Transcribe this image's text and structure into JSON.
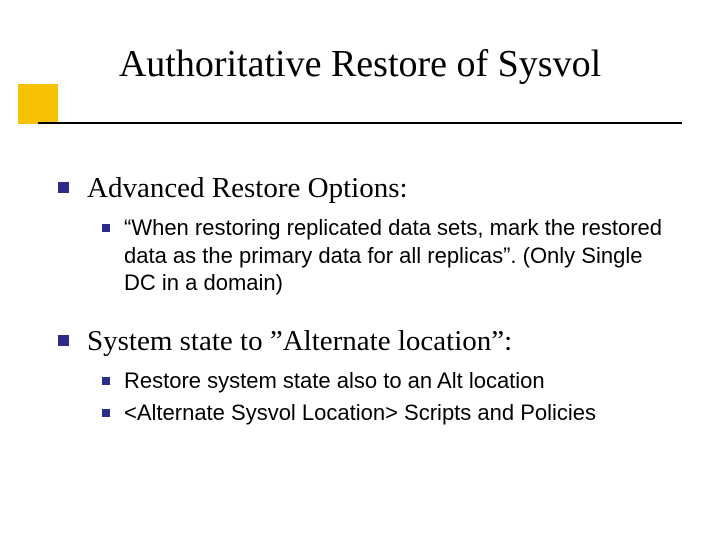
{
  "title": "Authoritative Restore of Sysvol",
  "items": [
    {
      "text": "Advanced Restore Options:",
      "sub": [
        "“When restoring replicated data sets, mark the restored data as the primary data for all replicas”. (Only Single DC in a domain)"
      ]
    },
    {
      "text": "System state to ”Alternate location”:",
      "sub": [
        "Restore system state also to an Alt location",
        "<Alternate Sysvol Location> Scripts and Policies"
      ]
    }
  ]
}
